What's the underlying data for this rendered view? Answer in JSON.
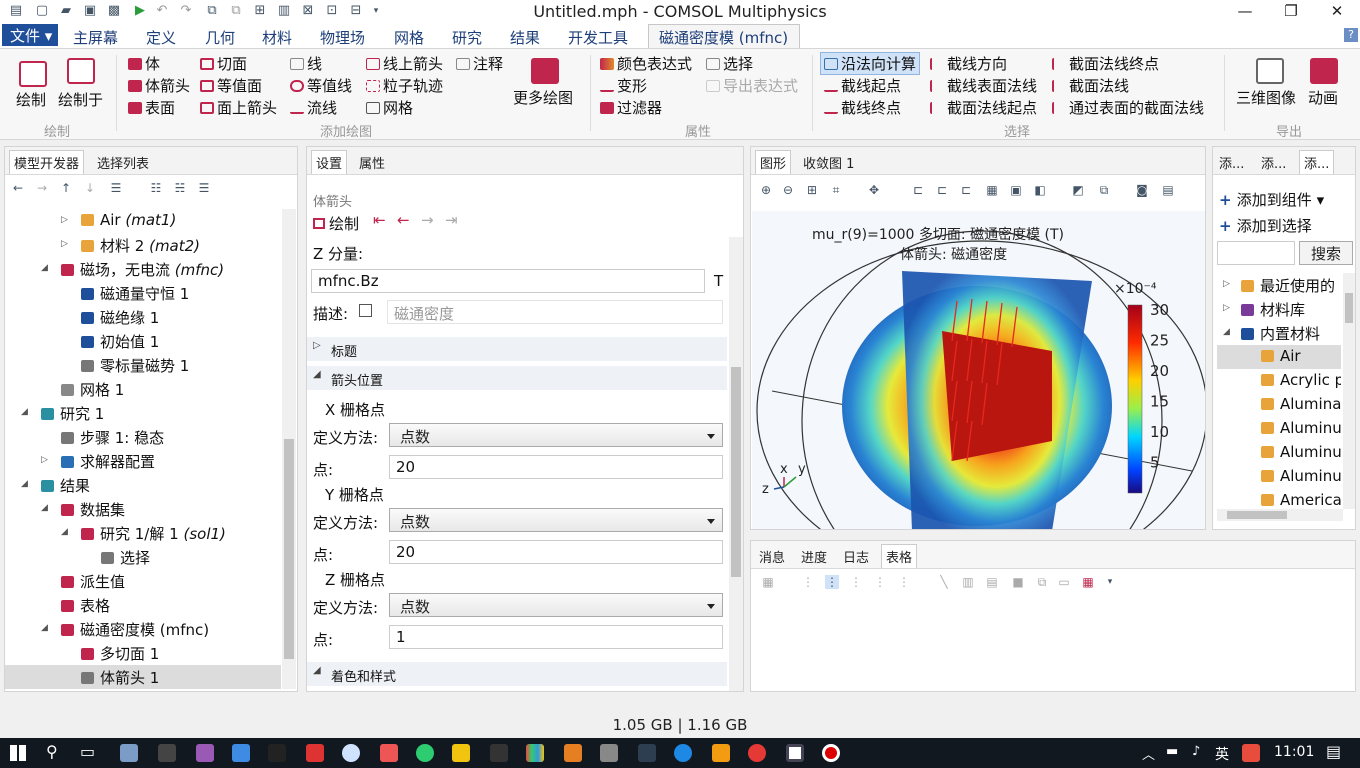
{
  "window": {
    "title": "Untitled.mph - COMSOL Multiphysics",
    "min": "—",
    "max": "❐",
    "close": "✕"
  },
  "menu": {
    "file": "文件",
    "tabs": [
      "主屏幕",
      "定义",
      "几何",
      "材料",
      "物理场",
      "网格",
      "研究",
      "结果",
      "开发工具"
    ],
    "context_tab": "磁通密度模 (mfnc)",
    "help": "?"
  },
  "ribbon": {
    "plot": "绘制",
    "plot_in": "绘制于",
    "plot_group": "绘制",
    "add_plot": {
      "items": [
        "体",
        "体箭头",
        "表面",
        "切面",
        "等值面",
        "面上箭头",
        "线",
        "等值线",
        "流线",
        "线上箭头",
        "粒子轨迹",
        "网格",
        "注释"
      ],
      "more": "更多绘图",
      "group": "添加绘图"
    },
    "attributes": {
      "items": [
        "颜色表达式",
        "变形",
        "过滤器",
        "选择",
        "导出表达式"
      ],
      "group": "属性"
    },
    "selection": {
      "items": [
        "沿法向计算",
        "截线起点",
        "截线终点",
        "截线方向",
        "截线表面法线",
        "截面法线起点",
        "截面法线终点",
        "截面法线",
        "通过表面的截面法线"
      ],
      "group": "选择"
    },
    "export": {
      "image": "三维图像",
      "animation": "动画",
      "group": "导出"
    }
  },
  "model_builder": {
    "tabs": [
      "模型开发器",
      "选择列表"
    ],
    "tree": [
      {
        "label": "Air",
        "tag": "(mat1)"
      },
      {
        "label": "材料 2",
        "tag": "(mat2)"
      },
      {
        "label": "磁场，无电流",
        "tag": "(mfnc)"
      },
      {
        "label": "磁通量守恒 1",
        "tag": ""
      },
      {
        "label": "磁绝缘 1",
        "tag": ""
      },
      {
        "label": "初始值 1",
        "tag": ""
      },
      {
        "label": "零标量磁势 1",
        "tag": ""
      },
      {
        "label": "网格 1",
        "tag": ""
      },
      {
        "label": "研究 1",
        "tag": ""
      },
      {
        "label": "步骤 1: 稳态",
        "tag": ""
      },
      {
        "label": "求解器配置",
        "tag": ""
      },
      {
        "label": "结果",
        "tag": ""
      },
      {
        "label": "数据集",
        "tag": ""
      },
      {
        "label": "研究 1/解 1",
        "tag": "(sol1)"
      },
      {
        "label": "选择",
        "tag": ""
      },
      {
        "label": "派生值",
        "tag": ""
      },
      {
        "label": "表格",
        "tag": ""
      },
      {
        "label": "磁通密度模 (mfnc)",
        "tag": ""
      },
      {
        "label": "多切面 1",
        "tag": ""
      },
      {
        "label": "体箭头 1",
        "tag": ""
      }
    ]
  },
  "settings": {
    "tabs": [
      "设置",
      "属性"
    ],
    "node_type": "体箭头",
    "plot": "绘制",
    "z_label": "Z 分量:",
    "z_value": "mfnc.Bz",
    "z_unit": "T",
    "desc_label": "描述:",
    "desc_value": "磁通密度",
    "sections": {
      "title": "标题",
      "arrow_position": "箭头位置",
      "coloring": "着色和样式"
    },
    "x_grid": "X 栅格点",
    "y_grid": "Y 栅格点",
    "z_grid": "Z 栅格点",
    "method_label": "定义方法:",
    "method_value": "点数",
    "points_label": "点:",
    "x_points": "20",
    "y_points": "20",
    "z_points": "1"
  },
  "graphics": {
    "tabs": [
      "图形",
      "收敛图 1"
    ],
    "title_line1": "mu_r(9)=1000   多切面: 磁通密度模 (T)",
    "title_line2": "体箭头: 磁通密度",
    "colorbar": {
      "scale": "×10⁻⁴",
      "ticks": [
        "30",
        "25",
        "20",
        "15",
        "10",
        "5"
      ]
    },
    "axes": {
      "x": "x",
      "y": "y",
      "z": "z"
    }
  },
  "messages": {
    "tabs": [
      "消息",
      "进度",
      "日志",
      "表格"
    ]
  },
  "add": {
    "tabs": [
      "添...",
      "添...",
      "添..."
    ],
    "add_component": "添加到组件",
    "add_selection": "添加到选择",
    "search": "搜索",
    "tree": [
      "最近使用的",
      "材料库",
      "内置材料",
      "Air",
      "Acrylic p",
      "Alumina",
      "Aluminu",
      "Aluminu",
      "Aluminu",
      "America"
    ]
  },
  "status": {
    "memory": "1.05 GB | 1.16 GB"
  },
  "taskbar": {
    "lang": "英",
    "time": "11:01"
  },
  "colors": {
    "accent": "#1f4e9b",
    "selected": "#dcdcdc"
  }
}
